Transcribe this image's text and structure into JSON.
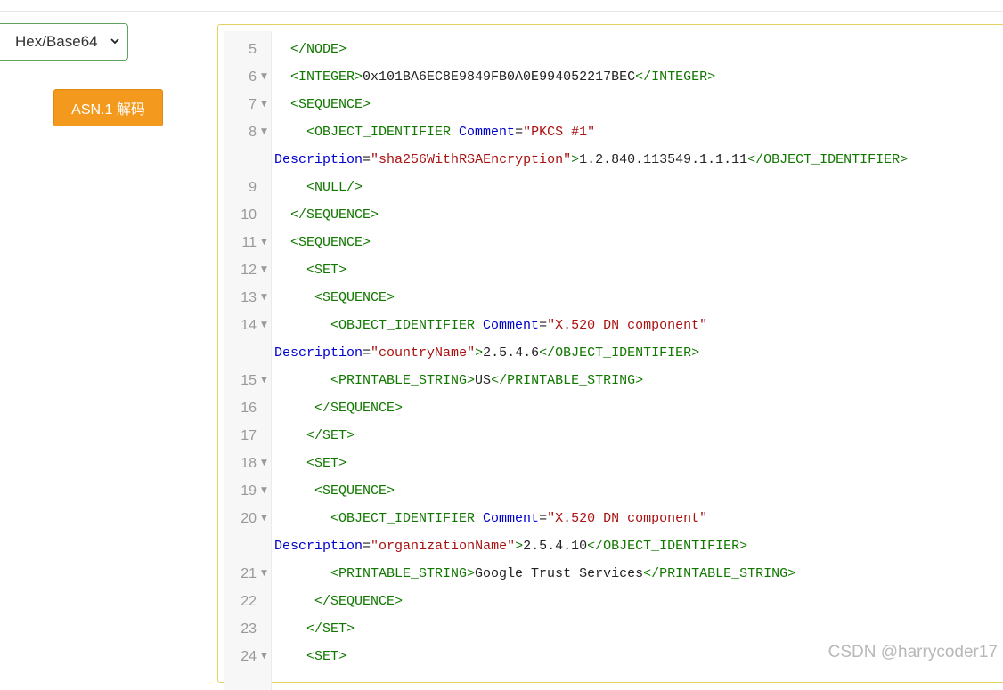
{
  "format_select": {
    "value": "Hex/Base64"
  },
  "decode_button": {
    "label": "ASN.1 解码"
  },
  "watermark": "CSDN @harrycoder17",
  "icons": {
    "select_chevron": "chevron-down-icon",
    "fold_marker": "fold-arrow-icon"
  },
  "colors": {
    "button": "#f39a1e",
    "tag": "#117700",
    "attr": "#0000cc",
    "string": "#aa1111"
  },
  "editor": {
    "lines": [
      {
        "num": "5",
        "fold": false,
        "wrap": false,
        "parts": [
          [
            "plain",
            "  "
          ],
          [
            "tag",
            "</NODE>"
          ]
        ]
      },
      {
        "num": "6",
        "fold": true,
        "wrap": false,
        "parts": [
          [
            "plain",
            "  "
          ],
          [
            "tag",
            "<INTEGER>"
          ],
          [
            "plain",
            "0x101BA6EC8E9849FB0A0E994052217BEC"
          ],
          [
            "tag",
            "</INTEGER>"
          ]
        ]
      },
      {
        "num": "7",
        "fold": true,
        "wrap": false,
        "parts": [
          [
            "plain",
            "  "
          ],
          [
            "tag",
            "<SEQUENCE>"
          ]
        ]
      },
      {
        "num": "8",
        "fold": true,
        "wrap": false,
        "parts": [
          [
            "plain",
            "    "
          ],
          [
            "tag",
            "<OBJECT_IDENTIFIER "
          ],
          [
            "attr",
            "Comment"
          ],
          [
            "plain",
            "="
          ],
          [
            "str",
            "\"PKCS #1\""
          ]
        ]
      },
      {
        "num": "",
        "fold": false,
        "wrap": true,
        "parts": [
          [
            "attr",
            "Description"
          ],
          [
            "plain",
            "="
          ],
          [
            "str",
            "\"sha256WithRSAEncryption\""
          ],
          [
            "tag",
            ">"
          ],
          [
            "plain",
            "1.2.840.113549.1.1.11"
          ],
          [
            "tag",
            "</OBJECT_IDENTIFIER>"
          ]
        ]
      },
      {
        "num": "9",
        "fold": false,
        "wrap": false,
        "parts": [
          [
            "plain",
            "    "
          ],
          [
            "tag",
            "<NULL/>"
          ]
        ]
      },
      {
        "num": "10",
        "fold": false,
        "wrap": false,
        "parts": [
          [
            "plain",
            "  "
          ],
          [
            "tag",
            "</SEQUENCE>"
          ]
        ]
      },
      {
        "num": "11",
        "fold": true,
        "wrap": false,
        "parts": [
          [
            "plain",
            "  "
          ],
          [
            "tag",
            "<SEQUENCE>"
          ]
        ]
      },
      {
        "num": "12",
        "fold": true,
        "wrap": false,
        "parts": [
          [
            "plain",
            "    "
          ],
          [
            "tag",
            "<SET>"
          ]
        ]
      },
      {
        "num": "13",
        "fold": true,
        "wrap": false,
        "parts": [
          [
            "plain",
            "     "
          ],
          [
            "tag",
            "<SEQUENCE>"
          ]
        ]
      },
      {
        "num": "14",
        "fold": true,
        "wrap": false,
        "parts": [
          [
            "plain",
            "       "
          ],
          [
            "tag",
            "<OBJECT_IDENTIFIER "
          ],
          [
            "attr",
            "Comment"
          ],
          [
            "plain",
            "="
          ],
          [
            "str",
            "\"X.520 DN component\""
          ]
        ]
      },
      {
        "num": "",
        "fold": false,
        "wrap": true,
        "parts": [
          [
            "attr",
            "Description"
          ],
          [
            "plain",
            "="
          ],
          [
            "str",
            "\"countryName\""
          ],
          [
            "tag",
            ">"
          ],
          [
            "plain",
            "2.5.4.6"
          ],
          [
            "tag",
            "</OBJECT_IDENTIFIER>"
          ]
        ]
      },
      {
        "num": "15",
        "fold": true,
        "wrap": false,
        "parts": [
          [
            "plain",
            "       "
          ],
          [
            "tag",
            "<PRINTABLE_STRING>"
          ],
          [
            "plain",
            "US"
          ],
          [
            "tag",
            "</PRINTABLE_STRING>"
          ]
        ]
      },
      {
        "num": "16",
        "fold": false,
        "wrap": false,
        "parts": [
          [
            "plain",
            "     "
          ],
          [
            "tag",
            "</SEQUENCE>"
          ]
        ]
      },
      {
        "num": "17",
        "fold": false,
        "wrap": false,
        "parts": [
          [
            "plain",
            "    "
          ],
          [
            "tag",
            "</SET>"
          ]
        ]
      },
      {
        "num": "18",
        "fold": true,
        "wrap": false,
        "parts": [
          [
            "plain",
            "    "
          ],
          [
            "tag",
            "<SET>"
          ]
        ]
      },
      {
        "num": "19",
        "fold": true,
        "wrap": false,
        "parts": [
          [
            "plain",
            "     "
          ],
          [
            "tag",
            "<SEQUENCE>"
          ]
        ]
      },
      {
        "num": "20",
        "fold": true,
        "wrap": false,
        "parts": [
          [
            "plain",
            "       "
          ],
          [
            "tag",
            "<OBJECT_IDENTIFIER "
          ],
          [
            "attr",
            "Comment"
          ],
          [
            "plain",
            "="
          ],
          [
            "str",
            "\"X.520 DN component\""
          ]
        ]
      },
      {
        "num": "",
        "fold": false,
        "wrap": true,
        "parts": [
          [
            "attr",
            "Description"
          ],
          [
            "plain",
            "="
          ],
          [
            "str",
            "\"organizationName\""
          ],
          [
            "tag",
            ">"
          ],
          [
            "plain",
            "2.5.4.10"
          ],
          [
            "tag",
            "</OBJECT_IDENTIFIER>"
          ]
        ]
      },
      {
        "num": "21",
        "fold": true,
        "wrap": false,
        "parts": [
          [
            "plain",
            "       "
          ],
          [
            "tag",
            "<PRINTABLE_STRING>"
          ],
          [
            "plain",
            "Google Trust Services"
          ],
          [
            "tag",
            "</PRINTABLE_STRING>"
          ]
        ]
      },
      {
        "num": "22",
        "fold": false,
        "wrap": false,
        "parts": [
          [
            "plain",
            "     "
          ],
          [
            "tag",
            "</SEQUENCE>"
          ]
        ]
      },
      {
        "num": "23",
        "fold": false,
        "wrap": false,
        "parts": [
          [
            "plain",
            "    "
          ],
          [
            "tag",
            "</SET>"
          ]
        ]
      },
      {
        "num": "24",
        "fold": true,
        "wrap": false,
        "parts": [
          [
            "plain",
            "    "
          ],
          [
            "tag",
            "<SET>"
          ]
        ]
      }
    ]
  }
}
